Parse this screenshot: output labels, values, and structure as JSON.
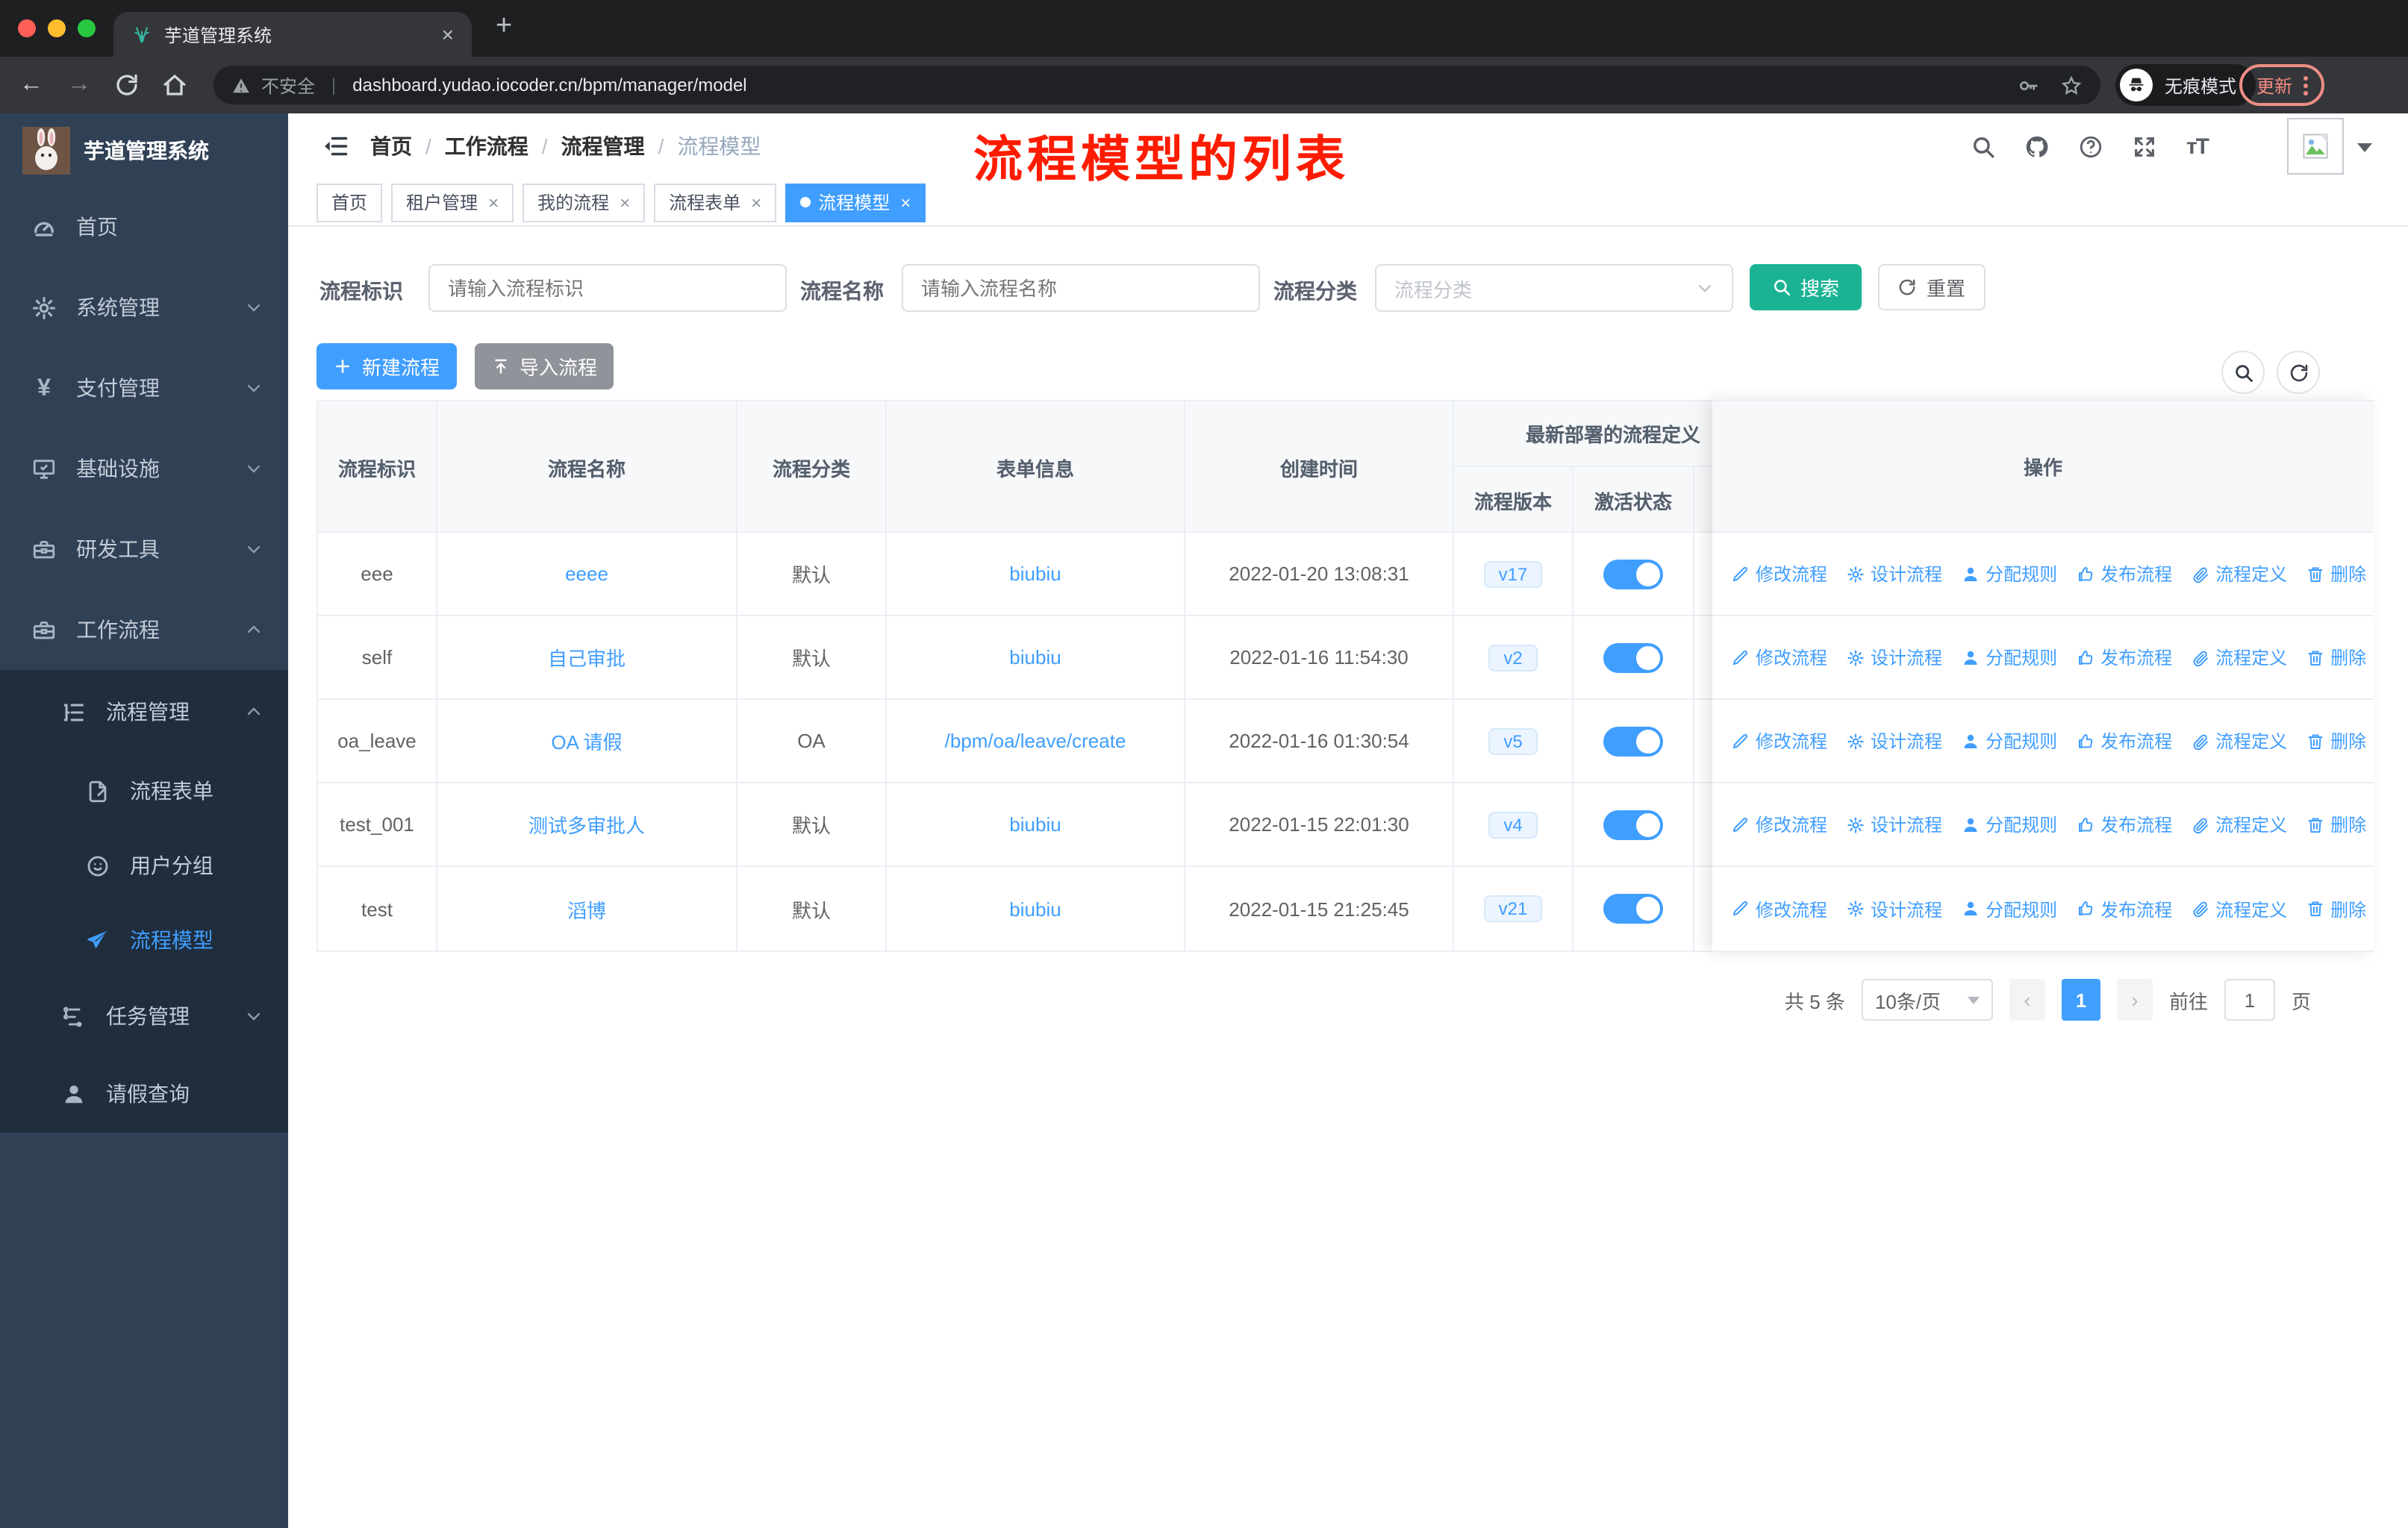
{
  "browser": {
    "tab_title": "芋道管理系统",
    "security_label": "不安全",
    "url": "dashboard.yudao.iocoder.cn/bpm/manager/model",
    "incognito_label": "无痕模式",
    "update_label": "更新"
  },
  "sidebar": {
    "title": "芋道管理系统",
    "items": [
      {
        "label": "首页"
      },
      {
        "label": "系统管理"
      },
      {
        "label": "支付管理"
      },
      {
        "label": "基础设施"
      },
      {
        "label": "研发工具"
      },
      {
        "label": "工作流程"
      }
    ],
    "submenu": {
      "group": "流程管理",
      "children": [
        "流程表单",
        "用户分组",
        "流程模型"
      ],
      "tasks": "任务管理",
      "leave": "请假查询"
    }
  },
  "header": {
    "breadcrumb": [
      "首页",
      "工作流程",
      "流程管理",
      "流程模型"
    ],
    "annotation": "流程模型的列表"
  },
  "tags": [
    {
      "label": "首页"
    },
    {
      "label": "租户管理"
    },
    {
      "label": "我的流程"
    },
    {
      "label": "流程表单"
    },
    {
      "label": "流程模型"
    }
  ],
  "filters": {
    "key_label": "流程标识",
    "key_placeholder": "请输入流程标识",
    "name_label": "流程名称",
    "name_placeholder": "请输入流程名称",
    "category_label": "流程分类",
    "category_placeholder": "流程分类",
    "search_label": "搜索",
    "reset_label": "重置"
  },
  "toolbar": {
    "create_label": "新建流程",
    "import_label": "导入流程"
  },
  "table": {
    "headers": {
      "code": "流程标识",
      "name": "流程名称",
      "category": "流程分类",
      "form": "表单信息",
      "created": "创建时间",
      "deploy_group": "最新部署的流程定义",
      "version": "流程版本",
      "active": "激活状态",
      "ops": "操作"
    },
    "row_actions": [
      "修改流程",
      "设计流程",
      "分配规则",
      "发布流程",
      "流程定义",
      "删除"
    ],
    "rows": [
      {
        "code": "eee",
        "name": "eeee",
        "category": "默认",
        "form": "biubiu",
        "created": "2022-01-20 13:08:31",
        "version": "v17"
      },
      {
        "code": "self",
        "name": "自己审批",
        "category": "默认",
        "form": "biubiu",
        "created": "2022-01-16 11:54:30",
        "version": "v2"
      },
      {
        "code": "oa_leave",
        "name": "OA 请假",
        "category": "OA",
        "form": "/bpm/oa/leave/create",
        "created": "2022-01-16 01:30:54",
        "version": "v5"
      },
      {
        "code": "test_001",
        "name": "测试多审批人",
        "category": "默认",
        "form": "biubiu",
        "created": "2022-01-15 22:01:30",
        "version": "v4"
      },
      {
        "code": "test",
        "name": "滔博",
        "category": "默认",
        "form": "biubiu",
        "created": "2022-01-15 21:25:45",
        "version": "v21"
      }
    ]
  },
  "pagination": {
    "total_label": "共 5 条",
    "page_size": "10条/页",
    "prev": "‹",
    "next": "›",
    "current_page": "1",
    "goto_label": "前往",
    "goto_value": "1",
    "page_unit": "页"
  },
  "colors": {
    "accent": "#409eff",
    "search_teal": "#1bb394",
    "annotation_red": "#fe1c00",
    "sidebar_bg": "#304156",
    "submenu_bg": "#1f2d3d"
  }
}
